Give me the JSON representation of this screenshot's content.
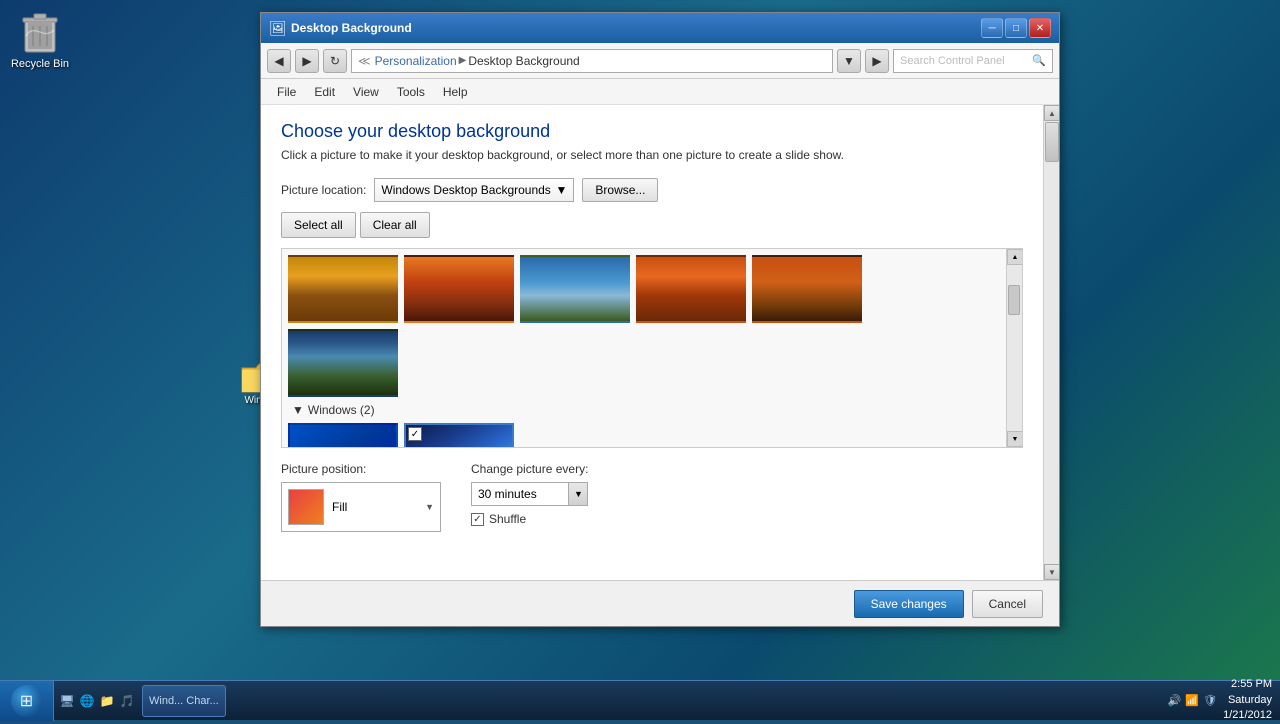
{
  "desktop": {
    "recycle_bin_label": "Recycle Bin",
    "folder_label": "Wind..."
  },
  "window": {
    "title": "Desktop Background",
    "title_bar_icon": "🖼",
    "min_btn": "─",
    "restore_btn": "□",
    "close_btn": "✕"
  },
  "address_bar": {
    "back_btn": "◀",
    "forward_btn": "▶",
    "refresh_btn": "↻",
    "path_prefix": "≪",
    "path_personalization": "Personalization",
    "path_chevron": "▶",
    "path_current": "Desktop Background",
    "search_placeholder": "Search Control Panel",
    "search_icon": "🔍"
  },
  "menu": {
    "file": "File",
    "edit": "Edit",
    "view": "View",
    "tools": "Tools",
    "help": "Help"
  },
  "main": {
    "title": "Choose your desktop background",
    "subtitle": "Click a picture to make it your desktop background, or select more than one picture to create a slide show.",
    "location_label": "Picture location:",
    "location_value": "Windows Desktop Backgrounds",
    "browse_btn": "Browse...",
    "select_all_btn": "Select all",
    "clear_all_btn": "Clear all"
  },
  "sections": {
    "windows_label": "Windows (2)",
    "collapse_icon": "▼"
  },
  "position": {
    "label": "Picture position:",
    "value": "Fill"
  },
  "change_picture": {
    "label": "Change picture every:",
    "value": "30 minutes",
    "shuffle_label": "Shuffle",
    "shuffle_checked": true
  },
  "footer": {
    "save_btn": "Save changes",
    "cancel_btn": "Cancel"
  },
  "taskbar": {
    "start_label": "",
    "app_label": "Wind... Char...",
    "time": "2:55 PM",
    "date": "Saturday\n1/21/2012",
    "icons": [
      "🔊",
      "🌐",
      "🛡"
    ]
  }
}
